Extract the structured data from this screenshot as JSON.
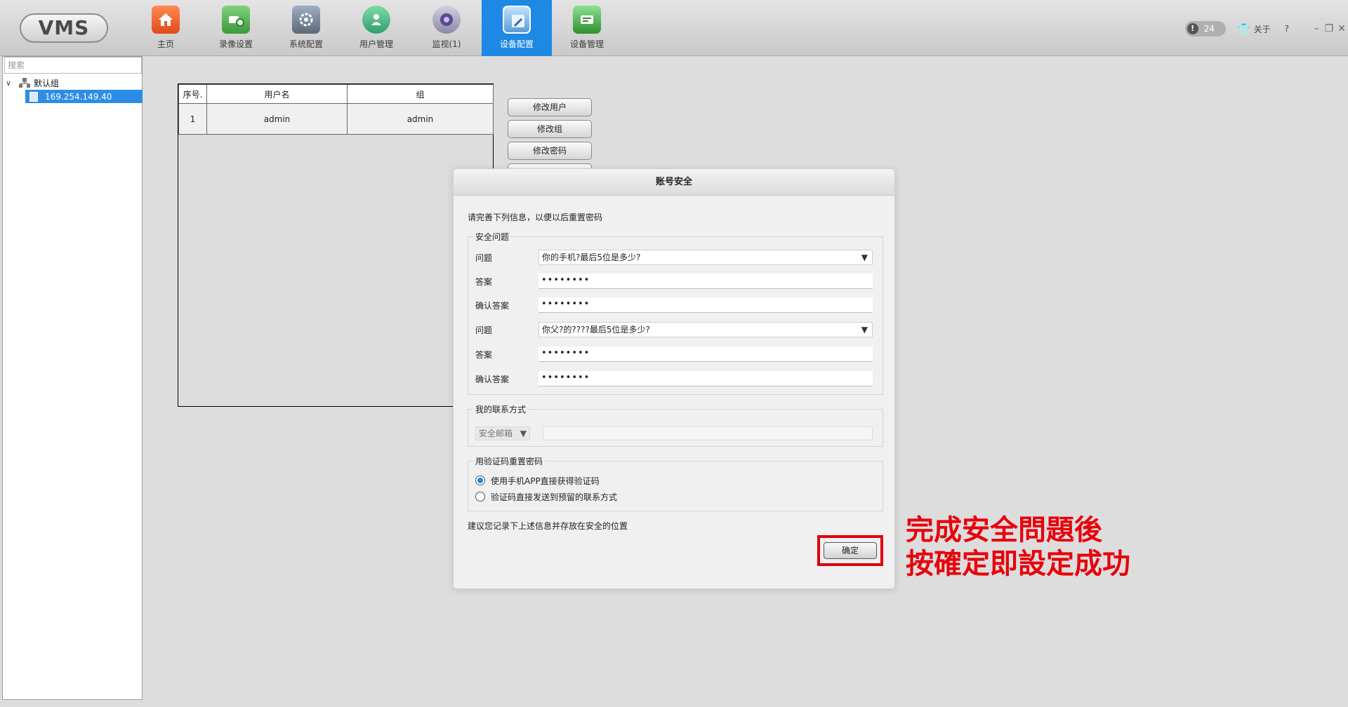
{
  "app": {
    "logo": "VMS"
  },
  "nav": [
    {
      "label": "主页",
      "icon": "home-icon",
      "active": false
    },
    {
      "label": "录像设置",
      "icon": "record-settings-icon",
      "active": false
    },
    {
      "label": "系统配置",
      "icon": "system-config-icon",
      "active": false
    },
    {
      "label": "用户管理",
      "icon": "user-management-icon",
      "active": false
    },
    {
      "label": "监视(1)",
      "icon": "monitor-icon",
      "active": false
    },
    {
      "label": "设备配置",
      "icon": "device-config-icon",
      "active": true
    },
    {
      "label": "设备管理",
      "icon": "device-management-icon",
      "active": false
    }
  ],
  "topright": {
    "alert_count": "24",
    "alert_icon": "!",
    "about": "关于",
    "help": "?",
    "minimize": "–",
    "restore": "❐",
    "close": "✕"
  },
  "sidebar": {
    "search_placeholder": "搜索",
    "group_label": "默认组",
    "device_label": "169.254.149.40"
  },
  "user_table": {
    "headers": [
      "序号.",
      "用户名",
      "组"
    ],
    "rows": [
      {
        "index": "1",
        "username": "admin",
        "group": "admin"
      }
    ]
  },
  "actions": {
    "edit_user": "修改用户",
    "edit_group": "修改组",
    "edit_password": "修改密码"
  },
  "dialog": {
    "title": "账号安全",
    "intro": "请完善下列信息，以便以后重置密码",
    "security_legend": "安全问题",
    "q1_label": "问题",
    "q1_value": "你的手机?最后5位是多少?",
    "a1_label": "答案",
    "a1_value": "••••••••",
    "c1_label": "确认答案",
    "c1_value": "••••••••",
    "q2_label": "问题",
    "q2_value": "你父?的????最后5位是多少?",
    "a2_label": "答案",
    "a2_value": "••••••••",
    "c2_label": "确认答案",
    "c2_value": "••••••••",
    "contact_legend": "我的联系方式",
    "contact_type": "安全邮箱",
    "reset_legend": "用验证码重置密码",
    "reset_option1": "使用手机APP直接获得验证码",
    "reset_option2": "验证码直接发送到预留的联系方式",
    "note": "建议您记录下上述信息并存放在安全的位置",
    "ok": "确定"
  },
  "annotation": {
    "line1": "完成安全問題後",
    "line2": "按確定即設定成功"
  },
  "colors": {
    "accent": "#1e88e5",
    "annotation_red": "#e8000b",
    "selected_row": "#2b8de6"
  }
}
